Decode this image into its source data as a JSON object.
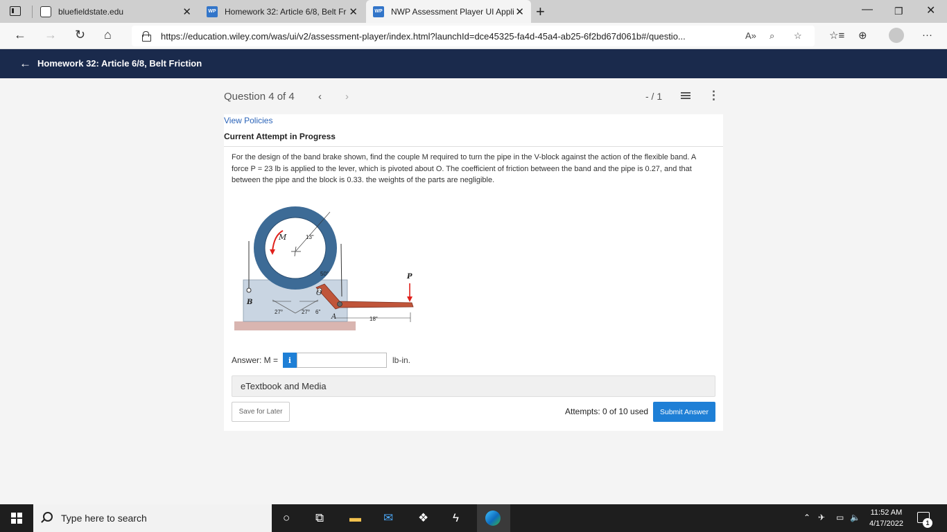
{
  "browser": {
    "tabs": [
      {
        "title": "bluefieldstate.edu",
        "icon": "lock-favicon-icon"
      },
      {
        "title": "Homework 32: Article 6/8, Belt Fr",
        "icon": "wp-favicon"
      },
      {
        "title": "NWP Assessment Player UI Appli",
        "icon": "wp-favicon"
      }
    ],
    "favicon_label": "WP",
    "url": "https://education.wiley.com/was/ui/v2/assessment-player/index.html?launchId=dce45325-fa4d-45a4-ab25-6f2bd67d061b#/questio..."
  },
  "header": {
    "title": "Homework 32: Article 6/8, Belt Friction"
  },
  "question_nav": {
    "counter": "Question 4 of 4",
    "score": "- / 1"
  },
  "card": {
    "view_policies": "View Policies",
    "attempt_status": "Current Attempt in Progress",
    "question_text": "For the design of the band brake shown, find the couple M required to turn the pipe in the V-block against the action of the flexible band. A force P = 23 lb is applied to the lever, which is pivoted about O. The coefficient of friction between the band and the pipe is 0.27, and that between the pipe and the block is 0.33. the weights of the parts are negligible.",
    "figure_labels": {
      "M": "M",
      "radius": "13\"",
      "angle50": "50°",
      "P": "P",
      "O": "O",
      "B": "B",
      "A": "A",
      "angle27a": "27°",
      "angle27b": "27°",
      "dist6": "6\"",
      "dist18": "18\""
    },
    "answer_label": "Answer: M =",
    "info_button": "i",
    "answer_value": "",
    "unit": "lb-in.",
    "etextbook": "eTextbook and Media",
    "save_later": "Save for Later",
    "attempts": "Attempts: 0 of 10 used",
    "submit": "Submit Answer"
  },
  "taskbar": {
    "search_placeholder": "Type here to search",
    "time": "11:52 AM",
    "date": "4/17/2022",
    "notification_count": "1"
  },
  "colors": {
    "header_bg": "#1a2a4c",
    "accent_blue": "#1e7fd6",
    "link_blue": "#2a63b8",
    "pipe_blue": "#3d6b96",
    "lever_red": "#c0553a",
    "arrow_red": "#e0201b"
  }
}
